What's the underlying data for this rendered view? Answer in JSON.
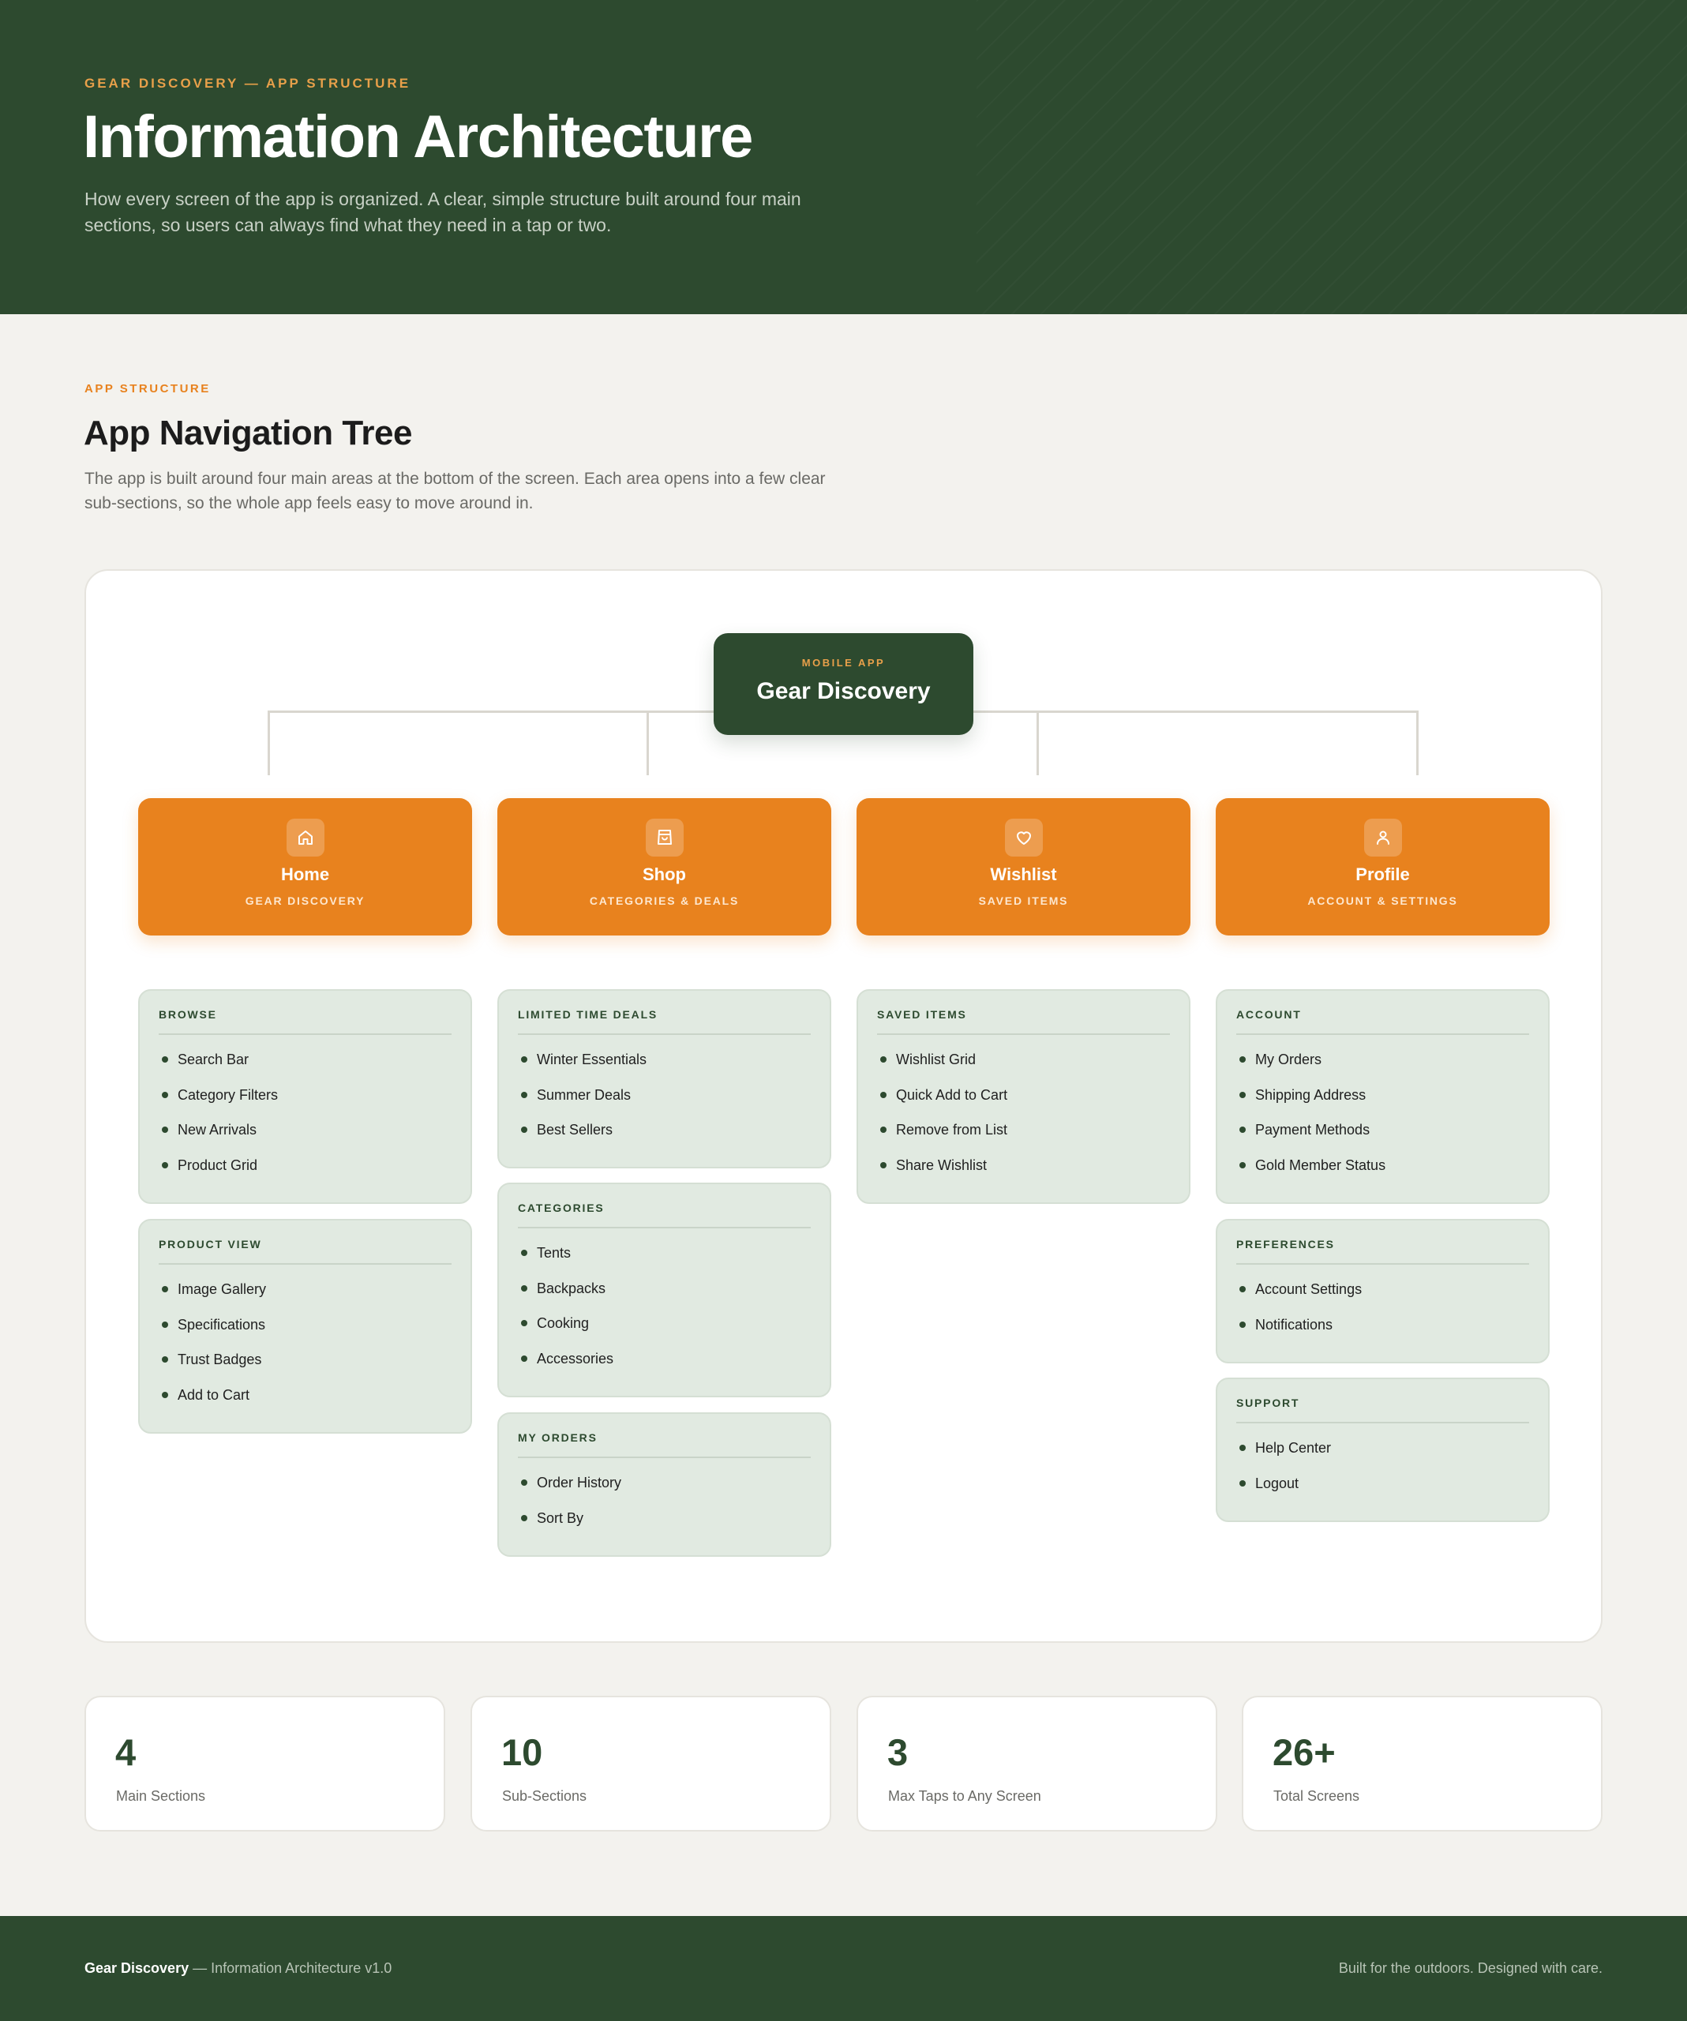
{
  "header": {
    "eyebrow": "GEAR DISCOVERY — APP STRUCTURE",
    "title": "Information Architecture",
    "description": "How every screen of the app is organized. A clear, simple structure built around four main sections, so users can always find what they need in a tap or two."
  },
  "section": {
    "eyebrow": "APP STRUCTURE",
    "title": "App Navigation Tree",
    "description": "The app is built around four main areas at the bottom of the screen. Each area opens into a few clear sub-sections, so the whole app feels easy to move around in."
  },
  "tree": {
    "root": {
      "eyebrow": "MOBILE APP",
      "title": "Gear Discovery"
    },
    "sections": [
      {
        "name": "Home",
        "subtitle": "GEAR DISCOVERY",
        "icon": "home-icon",
        "groups": [
          {
            "title": "BROWSE",
            "items": [
              "Search Bar",
              "Category Filters",
              "New Arrivals",
              "Product Grid"
            ]
          },
          {
            "title": "PRODUCT VIEW",
            "items": [
              "Image Gallery",
              "Specifications",
              "Trust Badges",
              "Add to Cart"
            ]
          }
        ]
      },
      {
        "name": "Shop",
        "subtitle": "CATEGORIES & DEALS",
        "icon": "shopping-bag-icon",
        "groups": [
          {
            "title": "LIMITED TIME DEALS",
            "items": [
              "Winter Essentials",
              "Summer Deals",
              "Best Sellers"
            ]
          },
          {
            "title": "CATEGORIES",
            "items": [
              "Tents",
              "Backpacks",
              "Cooking",
              "Accessories"
            ]
          },
          {
            "title": "MY ORDERS",
            "items": [
              "Order History",
              "Sort By"
            ]
          }
        ]
      },
      {
        "name": "Wishlist",
        "subtitle": "SAVED ITEMS",
        "icon": "heart-icon",
        "groups": [
          {
            "title": "SAVED ITEMS",
            "items": [
              "Wishlist Grid",
              "Quick Add to Cart",
              "Remove from List",
              "Share Wishlist"
            ]
          }
        ]
      },
      {
        "name": "Profile",
        "subtitle": "ACCOUNT & SETTINGS",
        "icon": "user-icon",
        "groups": [
          {
            "title": "ACCOUNT",
            "items": [
              "My Orders",
              "Shipping Address",
              "Payment Methods",
              "Gold Member Status"
            ]
          },
          {
            "title": "PREFERENCES",
            "items": [
              "Account Settings",
              "Notifications"
            ]
          },
          {
            "title": "SUPPORT",
            "items": [
              "Help Center",
              "Logout"
            ]
          }
        ]
      }
    ]
  },
  "stats": [
    {
      "value": "4",
      "label": "Main Sections"
    },
    {
      "value": "10",
      "label": "Sub-Sections"
    },
    {
      "value": "3",
      "label": "Max Taps to Any Screen"
    },
    {
      "value": "26+",
      "label": "Total Screens"
    }
  ],
  "footer": {
    "brand": "Gear Discovery",
    "version_text": "— Information Architecture v1.0",
    "tagline": "Built for the outdoors. Designed with care."
  },
  "colors": {
    "primary_green": "#2d4a2f",
    "accent_orange": "#e8821e",
    "group_bg": "#e1eae1",
    "page_bg": "#f3f2ee"
  }
}
